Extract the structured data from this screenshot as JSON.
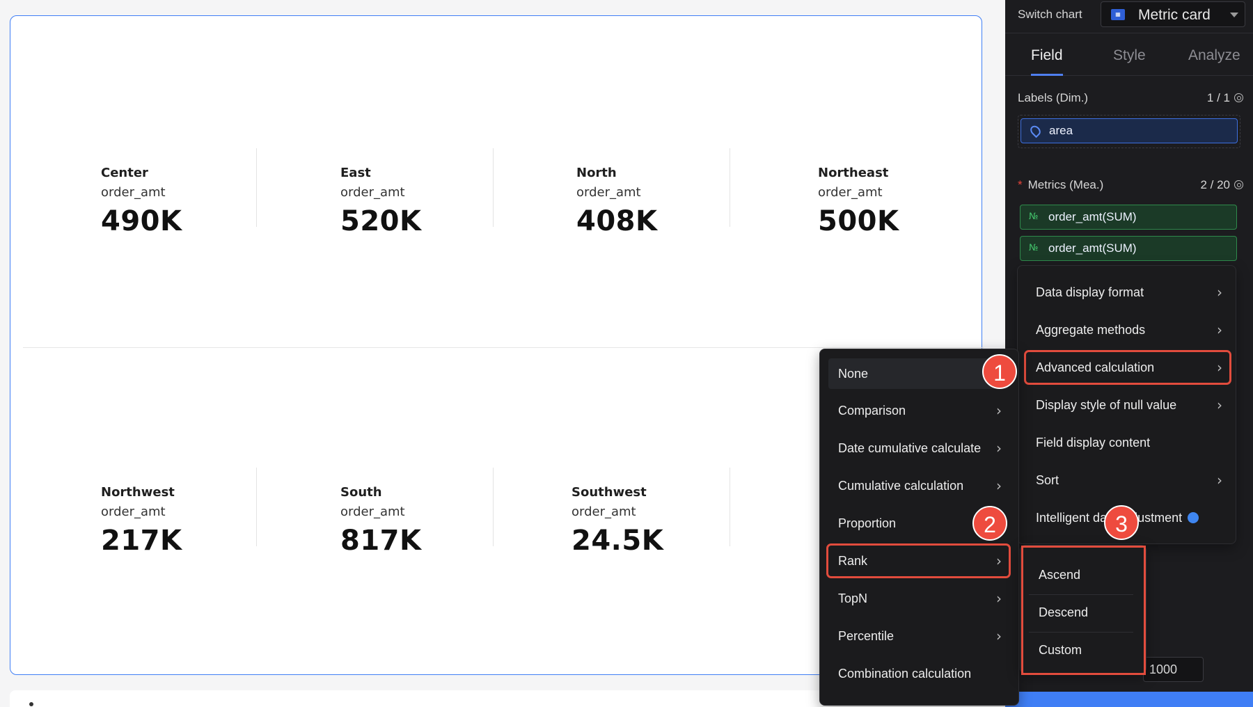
{
  "canvas": {
    "rows": [
      [
        {
          "name": "Center",
          "field": "order_amt",
          "value": "490K"
        },
        {
          "name": "East",
          "field": "order_amt",
          "value": "520K"
        },
        {
          "name": "North",
          "field": "order_amt",
          "value": "408K"
        },
        {
          "name": "Northeast",
          "field": "order_amt",
          "value": "500K"
        }
      ],
      [
        {
          "name": "Northwest",
          "field": "order_amt",
          "value": "217K"
        },
        {
          "name": "South",
          "field": "order_amt",
          "value": "817K"
        },
        {
          "name": "Southwest",
          "field": "order_amt",
          "value": "24.5K"
        }
      ]
    ]
  },
  "panel": {
    "switch_label": "Switch chart",
    "chart_type": "Metric card",
    "chart_icon": "chart-icon",
    "tabs": [
      "Field",
      "Style",
      "Analyze"
    ],
    "active_tab": "Field",
    "labels_title": "Labels (Dim.)",
    "labels_count": "1 / 1",
    "labels_fields": [
      "area"
    ],
    "metrics_title": "Metrics (Mea.)",
    "metrics_count": "2 / 20",
    "metrics_fields": [
      "order_amt(SUM)",
      "order_amt(SUM)"
    ],
    "metric_type_glyph": "№",
    "limit_value": "1000"
  },
  "field_menu": {
    "items": [
      {
        "label": "Data display format",
        "submenu": true
      },
      {
        "label": "Aggregate methods",
        "submenu": true
      },
      {
        "label": "Advanced calculation",
        "submenu": true,
        "highlighted": true
      },
      {
        "label": "Display style of null value",
        "submenu": true
      },
      {
        "label": "Field display content",
        "submenu": false
      },
      {
        "label": "Sort",
        "submenu": true
      },
      {
        "label": "Intelligent data adjustment",
        "submenu": false
      }
    ]
  },
  "advanced_menu": {
    "items": [
      {
        "label": "None",
        "submenu": false,
        "selected": true
      },
      {
        "label": "Comparison",
        "submenu": true
      },
      {
        "label": "Date cumulative calculate",
        "submenu": true
      },
      {
        "label": "Cumulative calculation",
        "submenu": true
      },
      {
        "label": "Proportion",
        "submenu": false
      },
      {
        "label": "Rank",
        "submenu": true,
        "highlighted": true
      },
      {
        "label": "TopN",
        "submenu": true
      },
      {
        "label": "Percentile",
        "submenu": true
      },
      {
        "label": "Combination calculation",
        "submenu": false
      }
    ]
  },
  "rank_menu": {
    "items": [
      "Ascend",
      "Descend",
      "Custom"
    ]
  },
  "markers": [
    "1",
    "2",
    "3"
  ],
  "colors": {
    "accent": "#3f7ef5",
    "highlight": "#e24c3d",
    "marker": "#ee4b3e",
    "panel_bg": "#1c1c1f"
  }
}
